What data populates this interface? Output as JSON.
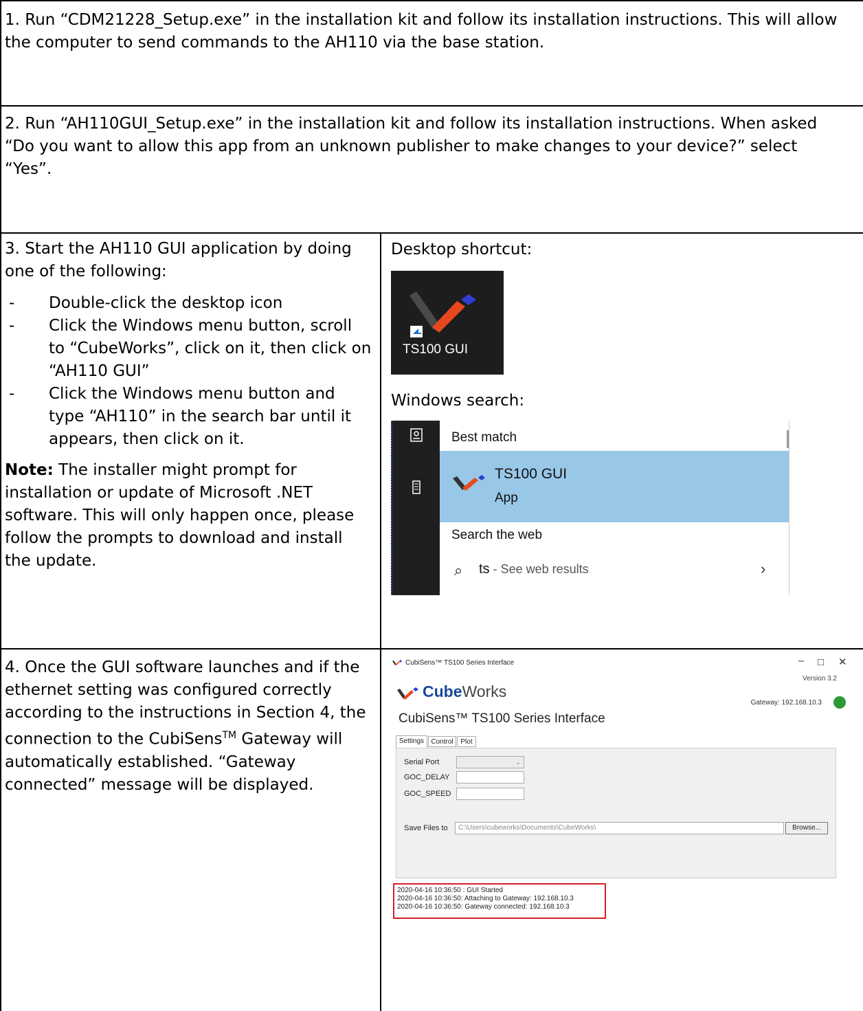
{
  "step1": {
    "text": "1. Run “CDM21228_Setup.exe” in the installation kit and follow its installation instructions.  This will allow the computer to send commands to the AH110 via the base station."
  },
  "step2": {
    "text": "2. Run “AH110GUI_Setup.exe” in the installation kit and follow its installation instructions.  When asked “Do you want to allow this app from an unknown publisher to make changes to your device?” select “Yes”."
  },
  "step3": {
    "intro": "3. Start the AH110 GUI application by doing one of the following:",
    "bullets": [
      "Double-click the desktop icon",
      "Click the Windows menu button, scroll to “CubeWorks”, click on it, then click on “AH110 GUI”",
      "Click the Windows menu button and type “AH110” in the search bar until it appears, then click on it."
    ],
    "note_label": "Note:",
    "note_text": " The installer might prompt for installation or update of Microsoft .NET software.  This will only happen once, please follow the prompts to download and install the update.",
    "desktop_label": "Desktop shortcut:",
    "shortcut_text": "TS100 GUI",
    "search_label": "Windows search:",
    "search": {
      "best_match": "Best match",
      "result_name": "TS100 GUI",
      "result_type": "App",
      "web_heading": "Search the web",
      "query": "ts",
      "query_suffix": " - See web results"
    }
  },
  "step4": {
    "text_a": "4. Once the GUI software launches and if the ethernet setting was configured correctly according to the instructions in Section 4, the connection to the CubiSens",
    "text_tm": "TM",
    "text_b": " Gateway will automatically established. “Gateway connected” message will be displayed.",
    "gui": {
      "window_title": "CubiSens™ TS100 Series Interface",
      "version": "Version 3.2",
      "brand_bold": "Cube",
      "brand_rest": "Works",
      "gateway": "Gateway: 192.168.10.3",
      "app_title": "CubiSens™ TS100 Series Interface",
      "tabs": [
        "Settings",
        "Control",
        "Plot"
      ],
      "fields": {
        "serial_port": "Serial Port",
        "goc_delay": "GOC_DELAY",
        "goc_speed": "GOC_SPEED",
        "save_files": "Save Files to"
      },
      "save_path": "C:\\Users\\cubeworks\\Documents\\CubeWorks\\",
      "browse": "Browse...",
      "log": [
        "2020-04-16 10:36:50 : GUI Started",
        "2020-04-16 10:36:50: Attaching to Gateway: 192.168.10.3",
        "2020-04-16 10:36:50: Gateway connected: 192.168.10.3"
      ]
    }
  },
  "colors": {
    "accent_blue": "#16489b",
    "logo_red": "#e8481e",
    "highlight": "#99c7e8",
    "status_green": "#2a9a34",
    "log_border": "#d61f26"
  }
}
